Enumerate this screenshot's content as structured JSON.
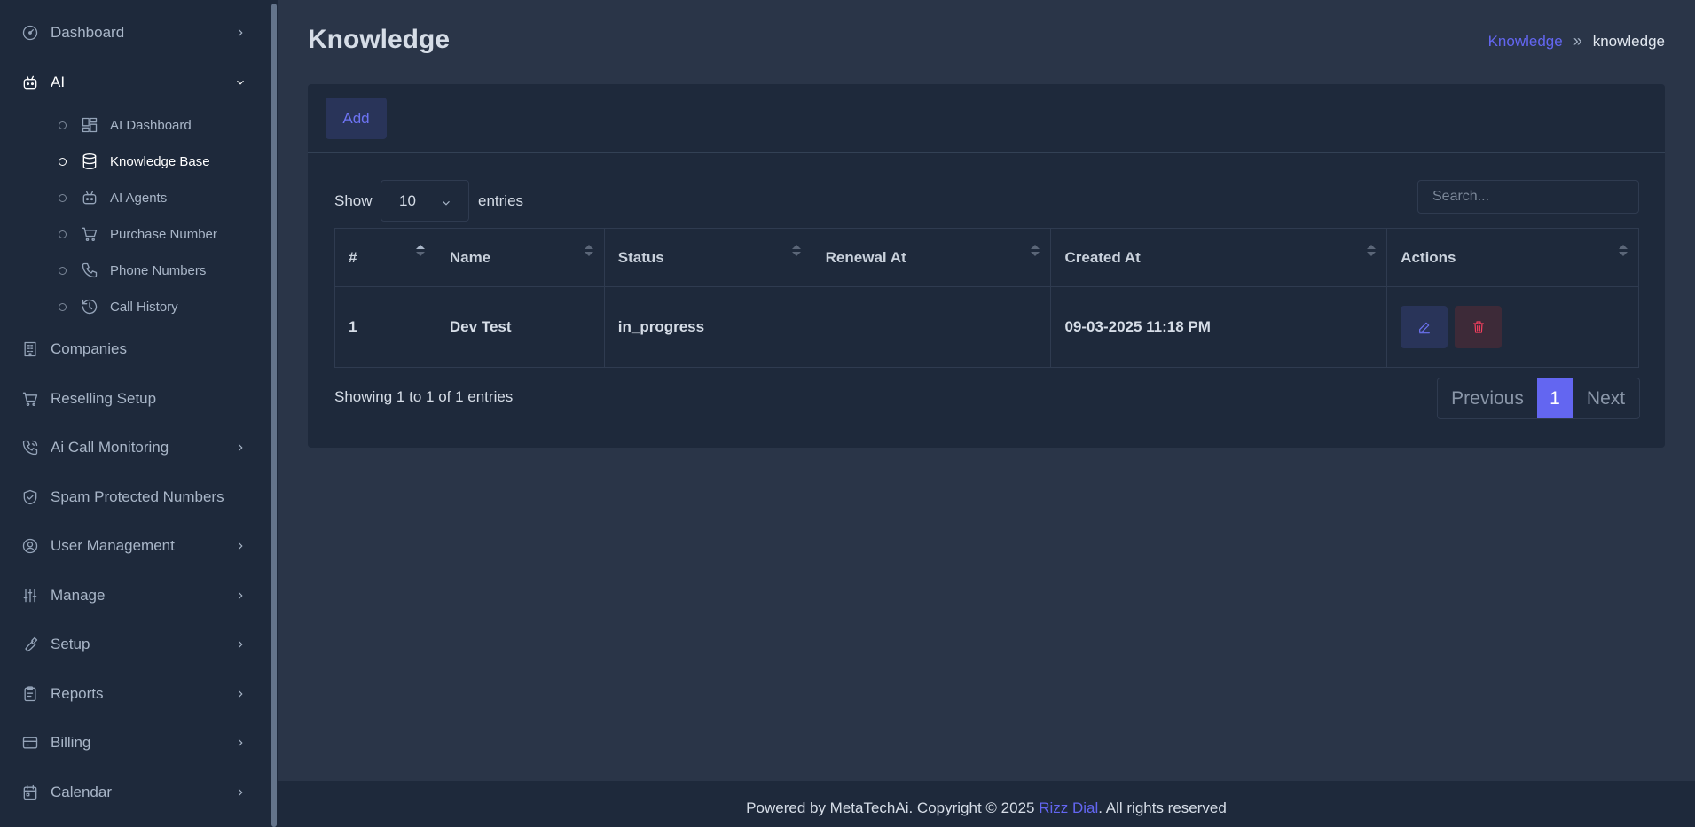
{
  "sidebar": {
    "items": [
      {
        "label": "Dashboard",
        "icon": "gauge-icon"
      },
      {
        "label": "AI",
        "icon": "robot-icon"
      },
      {
        "label": "Companies",
        "icon": "building-icon"
      },
      {
        "label": "Reselling Setup",
        "icon": "cart-icon"
      },
      {
        "label": "Ai Call Monitoring",
        "icon": "phone-call-icon"
      },
      {
        "label": "Spam Protected Numbers",
        "icon": "shield-check-icon"
      },
      {
        "label": "User Management",
        "icon": "user-circle-icon"
      },
      {
        "label": "Manage",
        "icon": "sliders-icon"
      },
      {
        "label": "Setup",
        "icon": "wrench-icon"
      },
      {
        "label": "Reports",
        "icon": "clipboard-icon"
      },
      {
        "label": "Billing",
        "icon": "credit-card-icon"
      },
      {
        "label": "Calendar",
        "icon": "calendar-icon"
      }
    ],
    "ai_sub": [
      {
        "label": "AI Dashboard",
        "icon": "layout-grid-icon"
      },
      {
        "label": "Knowledge Base",
        "icon": "database-icon"
      },
      {
        "label": "AI Agents",
        "icon": "robot-icon"
      },
      {
        "label": "Purchase Number",
        "icon": "cart-icon"
      },
      {
        "label": "Phone Numbers",
        "icon": "phone-icon"
      },
      {
        "label": "Call History",
        "icon": "history-icon"
      }
    ]
  },
  "header": {
    "title": "Knowledge",
    "breadcrumb": {
      "link": "Knowledge",
      "separator": "»",
      "current": "knowledge"
    }
  },
  "card": {
    "add_label": "Add",
    "show_label": "Show",
    "entries_value": "10",
    "entries_label": "entries",
    "search_placeholder": "Search...",
    "columns": [
      "#",
      "Name",
      "Status",
      "Renewal At",
      "Created At",
      "Actions"
    ],
    "rows": [
      {
        "num": "1",
        "name": "Dev Test",
        "status": "in_progress",
        "renewal_at": "",
        "created_at": "09-03-2025 11:18 PM"
      }
    ],
    "showing_text": "Showing 1 to 1 of 1 entries",
    "pagination": {
      "prev": "Previous",
      "page": "1",
      "next": "Next"
    }
  },
  "footer": {
    "prefix": "Powered by MetaTechAi. Copyright © 2025 ",
    "brand": "Rizz Dial",
    "suffix": ". All rights reserved"
  },
  "colors": {
    "accent": "#6366f1",
    "sidebar_bg": "#1e293b",
    "page_bg": "#2a3548",
    "danger": "#f43f5e"
  }
}
